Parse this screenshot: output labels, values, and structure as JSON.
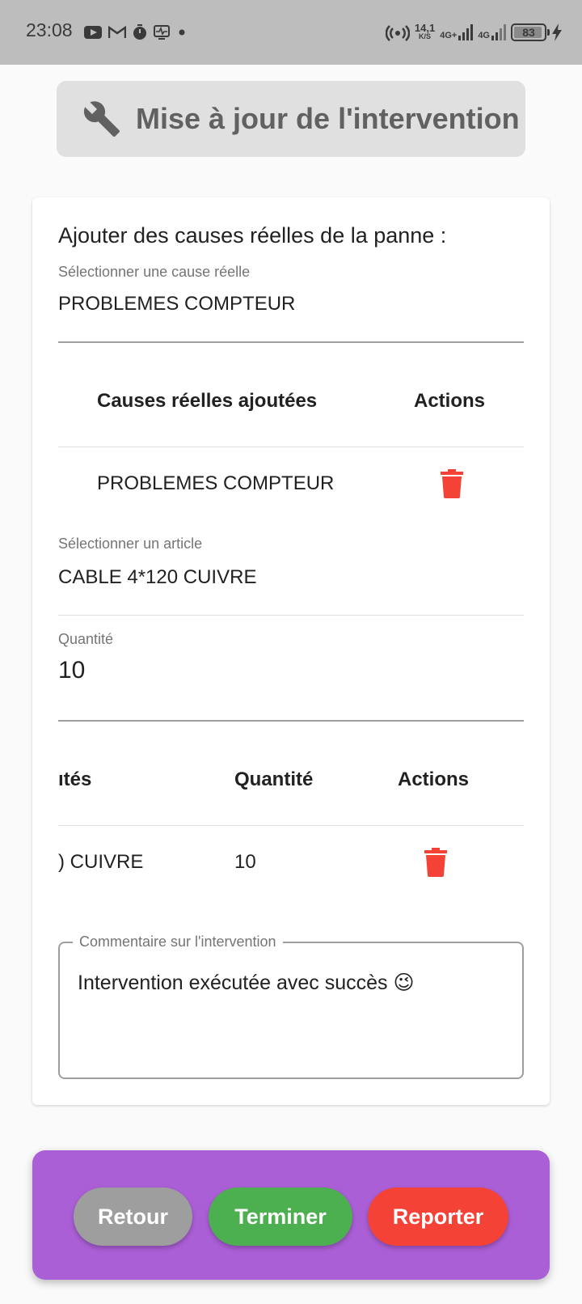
{
  "status_bar": {
    "time": "23:08",
    "left_icons": [
      "youtube-icon",
      "gmail-icon",
      "timer-icon",
      "activity-icon",
      "dot-icon"
    ],
    "net_speed_value": "14,1",
    "net_speed_unit": "K/S",
    "network_a": "4G+",
    "network_b": "4G",
    "battery_level": "83",
    "charging": true
  },
  "header": {
    "title": "Mise à jour de l'intervention",
    "icon": "wrench-icon"
  },
  "causes": {
    "section_title": "Ajouter des causes réelles de la panne :",
    "select_label": "Sélectionner une cause réelle",
    "select_value": "PROBLEMES COMPTEUR",
    "table_headers": [
      "Causes réelles ajoutées",
      "Actions"
    ],
    "rows": [
      {
        "cause": "PROBLEMES COMPTEUR",
        "action_icon": "trash-icon"
      }
    ]
  },
  "articles": {
    "select_label": "Sélectionner un article",
    "select_value": "CABLE 4*120 CUIVRE",
    "quantity_label": "Quantité",
    "quantity_value": "10",
    "table_headers_visible": [
      "ıtés",
      "Quantité",
      "Actions"
    ],
    "rows": [
      {
        "article_visible": ") CUIVRE",
        "quantity": "10",
        "action_icon": "trash-icon"
      }
    ]
  },
  "comment": {
    "label": "Commentaire sur l'intervention",
    "value": "Intervention exécutée avec succès 😉"
  },
  "actions": {
    "back": "Retour",
    "finish": "Terminer",
    "report": "Reporter"
  },
  "colors": {
    "delete": "#f44336",
    "finish": "#4caf50",
    "back": "#9e9e9e",
    "bar": "#ab5fd6"
  }
}
